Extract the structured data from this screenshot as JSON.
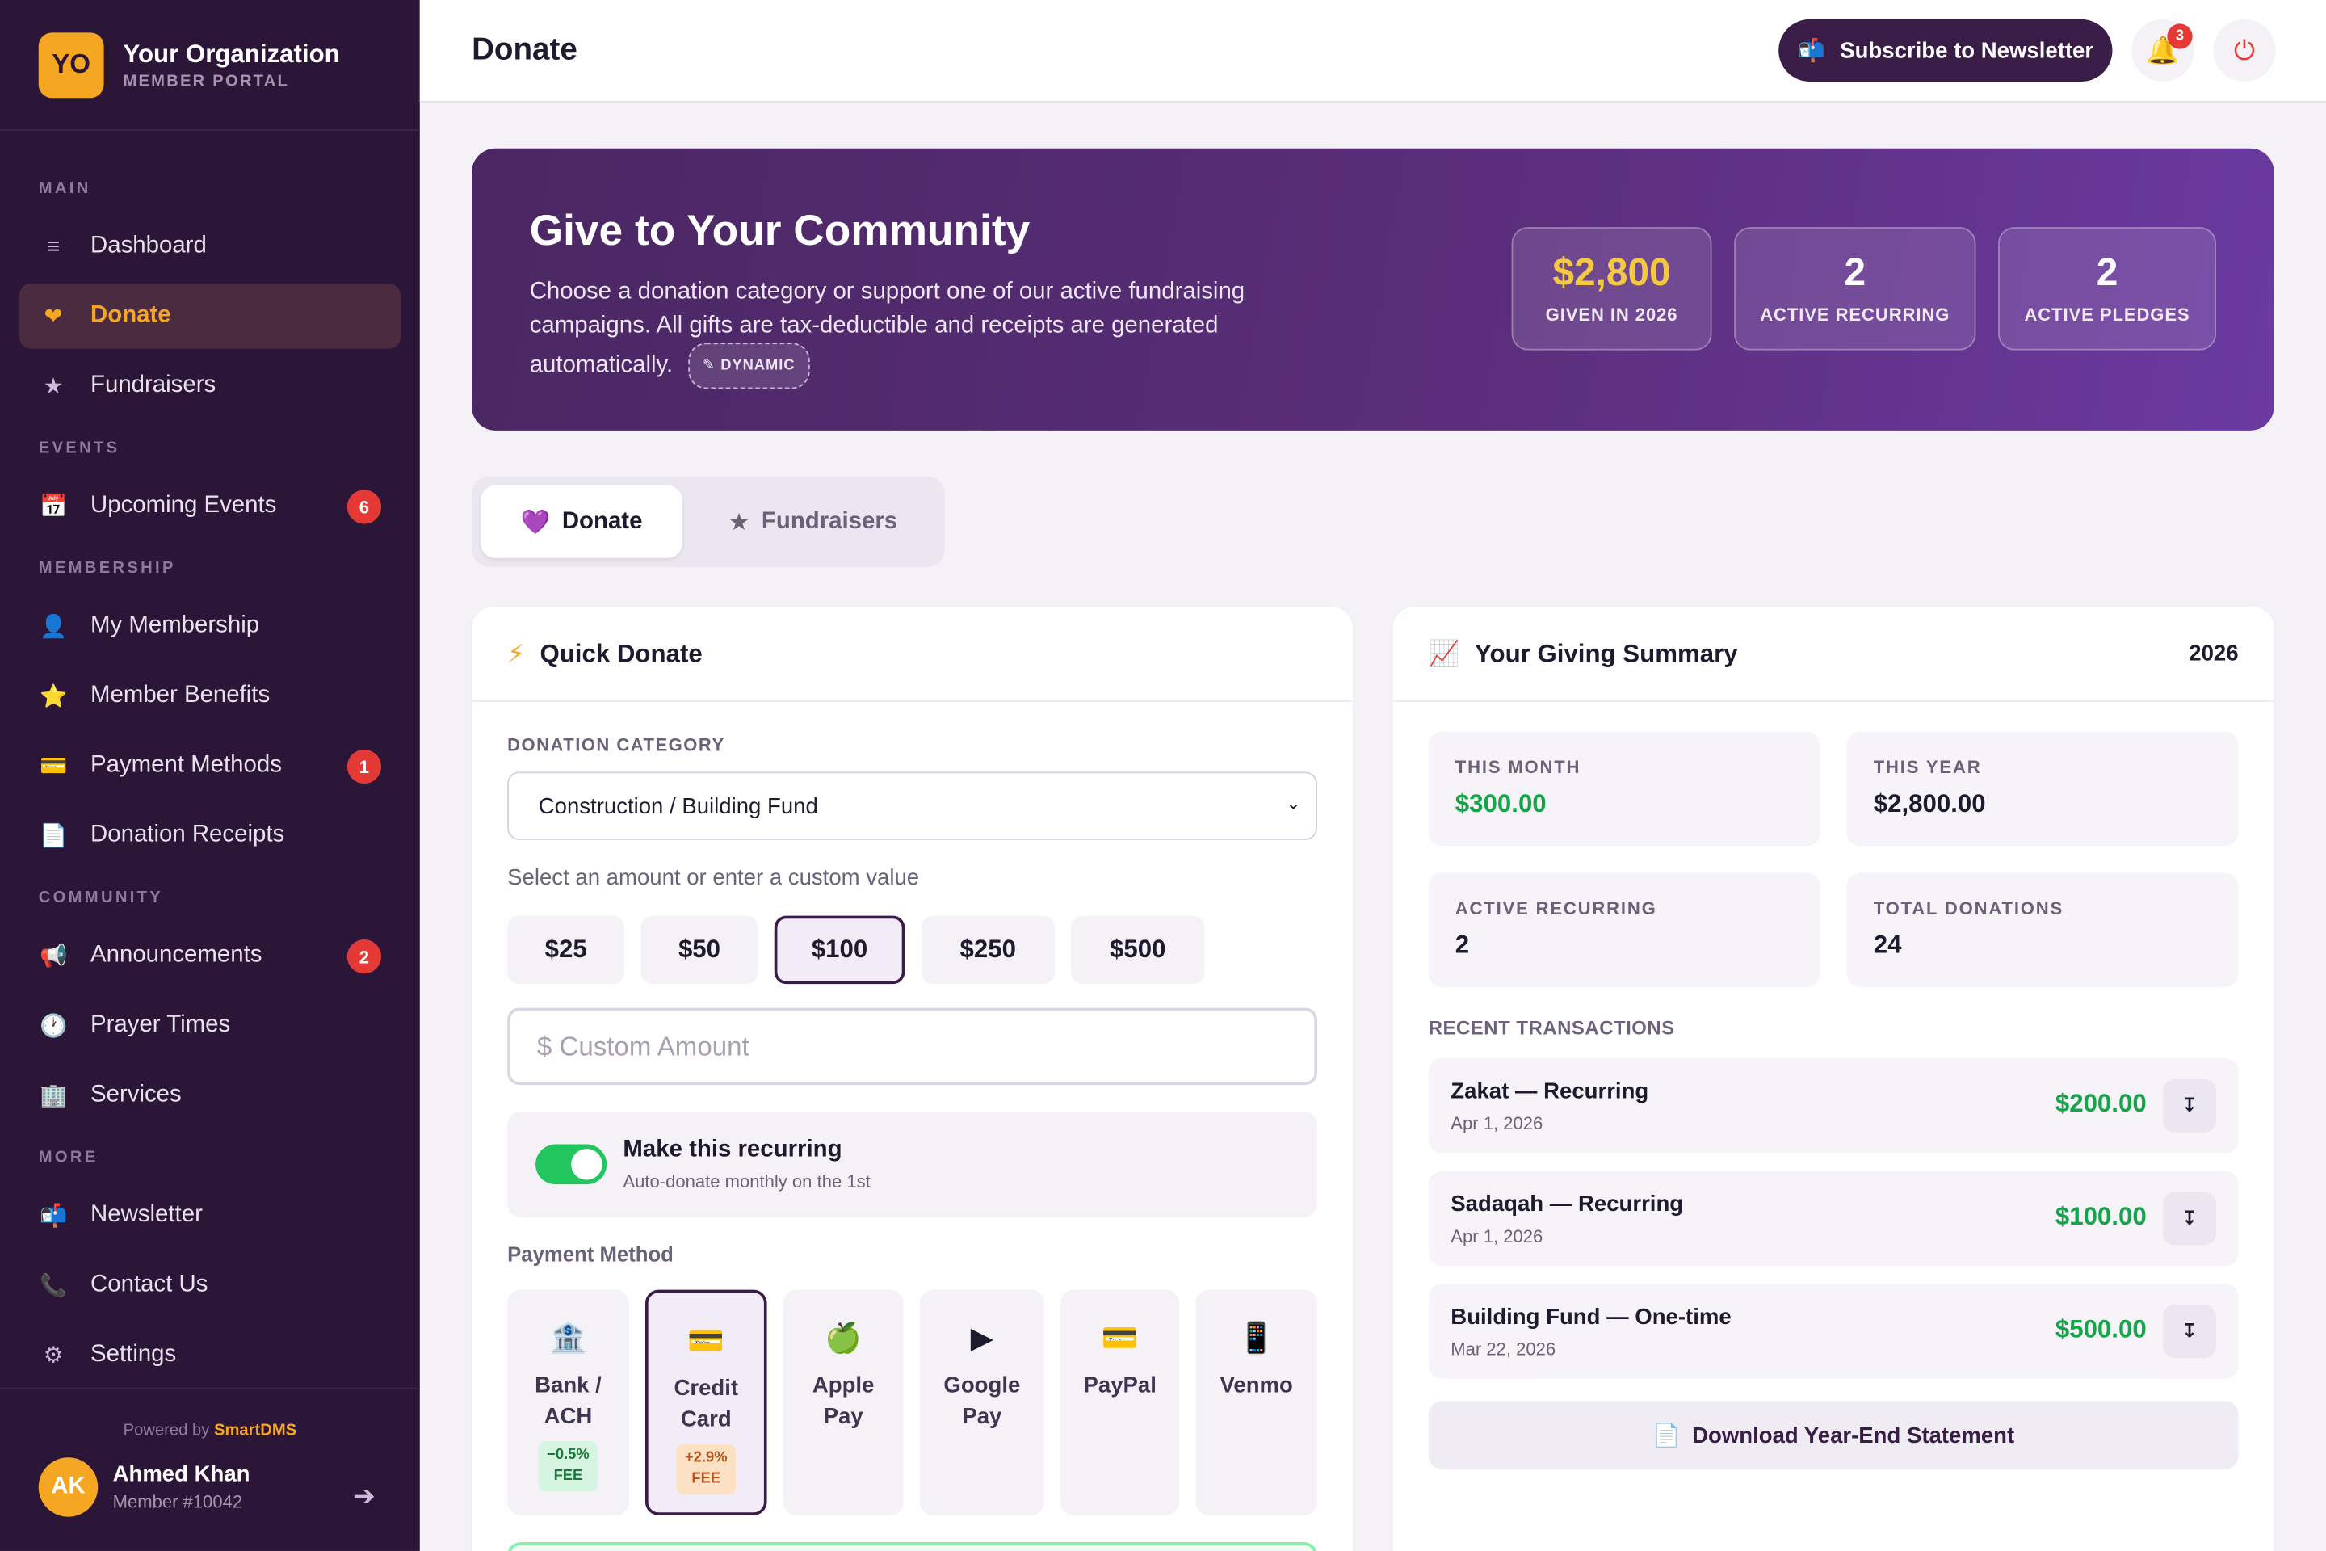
{
  "brand": {
    "initials": "YO",
    "name": "Your Organization",
    "sub": "MEMBER PORTAL"
  },
  "sidebar": {
    "sections": {
      "main": "MAIN",
      "events": "EVENTS",
      "membership": "MEMBERSHIP",
      "community": "COMMUNITY",
      "more": "MORE"
    },
    "items": [
      {
        "label": "Dashboard",
        "icon": "≡"
      },
      {
        "label": "Donate",
        "icon": "❤"
      },
      {
        "label": "Fundraisers",
        "icon": "★"
      },
      {
        "label": "Upcoming Events",
        "icon": "📅",
        "badge": "6"
      },
      {
        "label": "My Membership",
        "icon": "👤"
      },
      {
        "label": "Member Benefits",
        "icon": "⭐"
      },
      {
        "label": "Payment Methods",
        "icon": "💳",
        "badge": "1"
      },
      {
        "label": "Donation Receipts",
        "icon": "📄"
      },
      {
        "label": "Announcements",
        "icon": "📢",
        "badge": "2"
      },
      {
        "label": "Prayer Times",
        "icon": "🕐"
      },
      {
        "label": "Services",
        "icon": "🏢"
      },
      {
        "label": "Newsletter",
        "icon": "📬"
      },
      {
        "label": "Contact Us",
        "icon": "📞"
      },
      {
        "label": "Settings",
        "icon": "⚙"
      }
    ],
    "powered_prefix": "Powered by",
    "powered_brand": "SmartDMS",
    "user": {
      "initials": "AK",
      "name": "Ahmed Khan",
      "member": "Member #10042"
    },
    "logout_icon": "➔"
  },
  "topbar": {
    "title": "Donate",
    "subscribe_icon": "📬",
    "subscribe_label": "Subscribe to Newsletter",
    "bell_icon": "🔔",
    "bell_badge": "3",
    "power_icon": "⏻"
  },
  "hero": {
    "title": "Give to Your Community",
    "text": "Choose a donation category or support one of our active fundraising campaigns. All gifts are tax-deductible and receipts are generated automatically.",
    "chip": "✎ DYNAMIC",
    "stats": [
      {
        "value": "$2,800",
        "label": "GIVEN IN 2026"
      },
      {
        "value": "2",
        "label": "ACTIVE RECURRING"
      },
      {
        "value": "2",
        "label": "ACTIVE PLEDGES"
      }
    ]
  },
  "tabs": [
    {
      "icon": "💜",
      "label": "Donate"
    },
    {
      "icon": "★",
      "label": "Fundraisers"
    }
  ],
  "quick_donate": {
    "icon": "⚡",
    "title": "Quick Donate",
    "category_label": "DONATION CATEGORY",
    "category_value": "Construction / Building Fund",
    "amount_hint": "Select an amount or enter a custom value",
    "amounts": [
      "$25",
      "$50",
      "$100",
      "$250",
      "$500"
    ],
    "custom_placeholder": "$ Custom Amount",
    "recurring_title": "Make this recurring",
    "recurring_sub": "Auto-donate monthly on the 1st",
    "payment_label": "Payment Method",
    "methods": [
      {
        "icon": "🏦",
        "line1": "Bank /",
        "line2": "ACH",
        "fee1": "−0.5%",
        "fee2": "FEE"
      },
      {
        "icon": "💳",
        "line1": "Credit",
        "line2": "Card",
        "fee1": "+2.9%",
        "fee2": "FEE"
      },
      {
        "icon": "🍏",
        "line1": "Apple",
        "line2": "Pay"
      },
      {
        "icon": "▶",
        "line1": "Google",
        "line2": "Pay"
      },
      {
        "icon": "💳",
        "line1": "PayPal",
        "line2": ""
      },
      {
        "icon": "📱",
        "line1": "Venmo",
        "line2": ""
      }
    ]
  },
  "giving": {
    "icon": "📈",
    "title": "Your Giving Summary",
    "year": "2026",
    "boxes": [
      {
        "label": "THIS MONTH",
        "value": "$300.00"
      },
      {
        "label": "THIS YEAR",
        "value": "$2,800.00"
      },
      {
        "label": "ACTIVE RECURRING",
        "value": "2"
      },
      {
        "label": "TOTAL DONATIONS",
        "value": "24"
      }
    ],
    "recent_label": "RECENT TRANSACTIONS",
    "transactions": [
      {
        "name": "Zakat — Recurring",
        "date": "Apr 1, 2026",
        "amount": "$200.00"
      },
      {
        "name": "Sadaqah — Recurring",
        "date": "Apr 1, 2026",
        "amount": "$100.00"
      },
      {
        "name": "Building Fund — One-time",
        "date": "Mar 22, 2026",
        "amount": "$500.00"
      }
    ],
    "download_icon_glyph": "↧",
    "statement_icon": "📄",
    "statement_label": "Download Year-End Statement"
  }
}
